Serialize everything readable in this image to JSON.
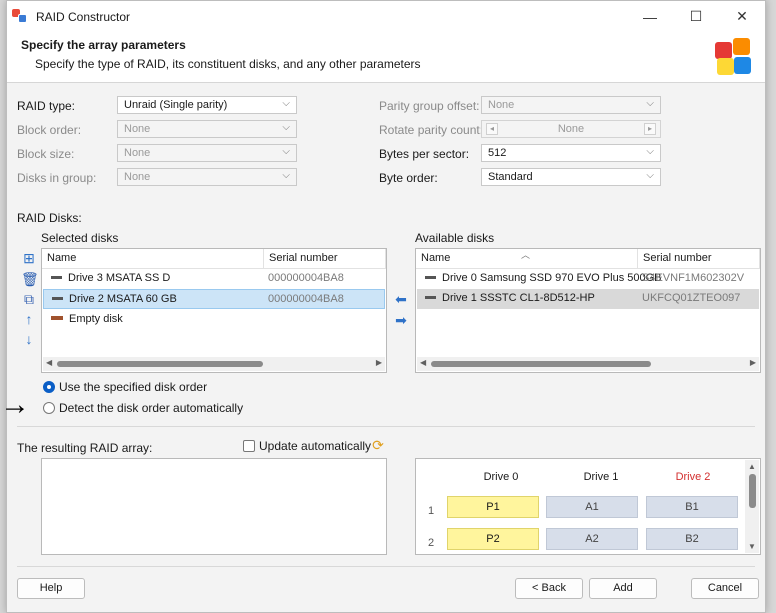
{
  "window": {
    "title": "RAID Constructor",
    "controls": [
      "—",
      "☐",
      "✕"
    ]
  },
  "header": {
    "title": "Specify the array parameters",
    "subtitle": "Specify the type of RAID, its constituent disks, and any other parameters"
  },
  "params": {
    "raid_type": {
      "label": "RAID type:",
      "value": "Unraid (Single parity)"
    },
    "block_order": {
      "label": "Block order:",
      "value": "None"
    },
    "block_size": {
      "label": "Block size:",
      "value": "None"
    },
    "disks_in_group": {
      "label": "Disks in group:",
      "value": "None"
    },
    "parity_group_offset": {
      "label": "Parity group offset:",
      "value": "None"
    },
    "rotate_parity_count": {
      "label": "Rotate parity count:",
      "value": "None"
    },
    "bytes_per_sector": {
      "label": "Bytes per sector:",
      "value": "512"
    },
    "byte_order": {
      "label": "Byte order:",
      "value": "Standard"
    }
  },
  "raid_disks": {
    "label": "RAID Disks:",
    "selected_label": "Selected disks",
    "available_label": "Available disks",
    "columns": {
      "name": "Name",
      "serial": "Serial number"
    },
    "selected": [
      {
        "name": "Drive 3 MSATA SS D",
        "serial": "000000004BA8"
      },
      {
        "name": "Drive 2 MSATA 60 GB",
        "serial": "000000004BA8"
      },
      {
        "name": "Empty disk",
        "serial": ""
      }
    ],
    "available": [
      {
        "name": "Drive 0 Samsung SSD 970 EVO Plus 500GB",
        "serial": "S4EVNF1M602302V"
      },
      {
        "name": "Drive 1 SSSTC CL1-8D512-HP",
        "serial": "UKFCQ01ZTEO097"
      }
    ]
  },
  "order": {
    "use_specified": "Use the specified disk order",
    "detect_auto": "Detect the disk order automatically",
    "selected": "use_specified"
  },
  "result": {
    "label": "The resulting RAID array:",
    "update_auto": "Update automatically",
    "update_checked": false,
    "drives": [
      "Drive 0",
      "Drive 1",
      "Drive 2"
    ],
    "drive_colors": [
      "#1a1a1a",
      "#1a1a1a",
      "#d32f2f"
    ],
    "rows": [
      {
        "num": "1",
        "cells": [
          "P1",
          "A1",
          "B1"
        ]
      },
      {
        "num": "2",
        "cells": [
          "P2",
          "A2",
          "B2"
        ]
      }
    ]
  },
  "buttons": {
    "help": "Help",
    "back": "< Back",
    "add": "Add",
    "cancel": "Cancel"
  },
  "icons": {
    "arrow_pointer": "→"
  }
}
